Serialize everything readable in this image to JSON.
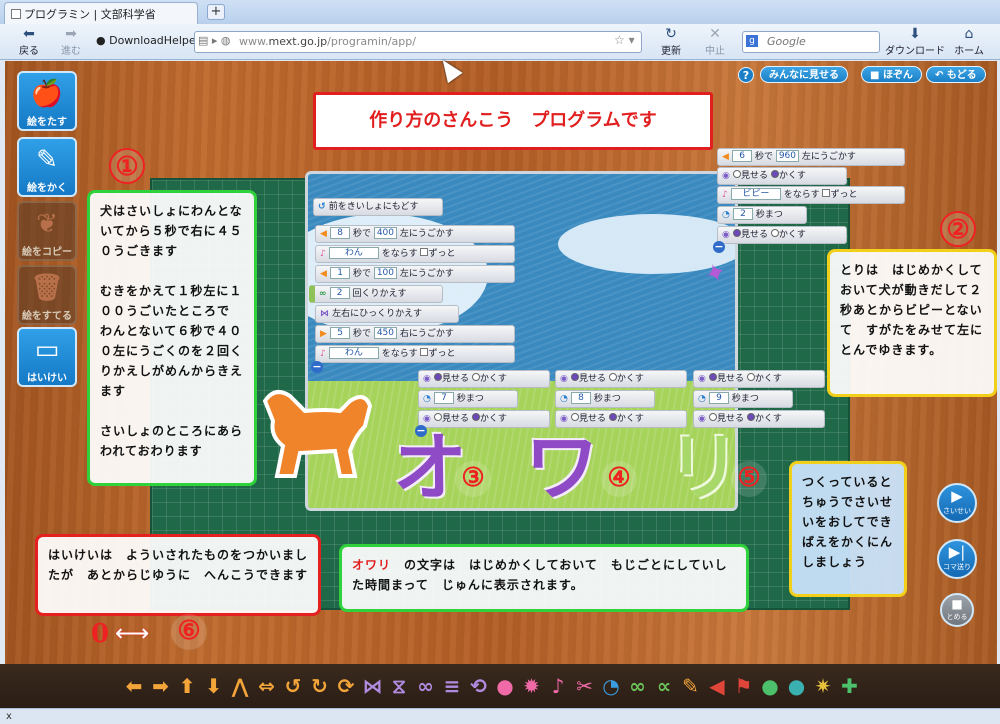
{
  "browser": {
    "tab_title": "プログラミン | 文部科学省",
    "tab_close": "×",
    "new_tab": "+",
    "nav": {
      "back": "戻る",
      "forward": "進む",
      "reload": "更新",
      "stop": "中止",
      "download": "ダウンロード",
      "home": "ホーム"
    },
    "extension": "DownloadHelper",
    "url_prefix": "www.",
    "url_domain": "mext.go.jp",
    "url_path": "/programin/app/",
    "search_placeholder": "Google",
    "search_engine_icon": "g"
  },
  "app": {
    "sidebar": [
      {
        "label": "絵をたす",
        "icon": "apple-plus-icon",
        "enabled": true
      },
      {
        "label": "絵をかく",
        "icon": "pencil-icon",
        "enabled": true
      },
      {
        "label": "絵をコピー",
        "icon": "apples-copy-icon",
        "enabled": false
      },
      {
        "label": "絵をすてる",
        "icon": "trash-icon",
        "enabled": false
      },
      {
        "label": "はいけい",
        "icon": "background-icon",
        "enabled": true
      }
    ],
    "top_buttons": {
      "help": "?",
      "share": "みんなに見せる",
      "save": "ほぞん",
      "back": "もどる"
    },
    "title_box": "作り方のさんこう　プログラムです",
    "numbers": {
      "n1": "①",
      "n2": "②",
      "n3": "③",
      "n4": "④",
      "n5": "⑤",
      "n6": "⑥",
      "n0": "0"
    },
    "callouts": {
      "dog": "犬はさいしょにわんとないてから５秒で右に４５０うごきます\n\nむきをかえて１秒左に１００うごいたところで　わんとないて６秒で４００左にうごくのを２回くりかえしがめんからきえます\n\nさいしょのところにあらわれておわります",
      "bird": "とりは　はじめかくしておいて犬が動きだして２秒あとからビピーとないて　すがたをみせて左にとんでゆきます。",
      "background": "はいけいは　よういされたものをつかいましたが　あとからじゆうに　へんこうできます",
      "owari_word": "オワリ",
      "owari_rest": "　の文字は　はじめかくしておいて　もじごとにしていした時間まって　じゅんに表示されます。",
      "play_tip": "つくっているとちゅうでさいせいをおしてできばえをかくにんしましょう"
    },
    "dog_script": {
      "reset": "前をきいしょにもどす",
      "move1": {
        "num": "8",
        "sec": "秒で",
        "dist": "400",
        "dir": "左にうごかす"
      },
      "sound1": {
        "name": "わん",
        "label": "をならす",
        "loop": "ずっと"
      },
      "move2": {
        "num": "1",
        "sec": "秒で",
        "dist": "100",
        "dir": "左にうごかす"
      },
      "repeat": {
        "num": "2",
        "label": "回くりかえす"
      },
      "flip": "左右にひっくりかえす",
      "move3": {
        "num": "5",
        "sec": "秒で",
        "dist": "450",
        "dir": "右にうごかす"
      },
      "sound2": {
        "name": "わん",
        "label": "をならす",
        "loop": "ずっと"
      }
    },
    "bird_script": {
      "move": {
        "num": "6",
        "sec": "秒で",
        "dist": "960",
        "dir": "左にうごかす"
      },
      "visible": {
        "show": "見せる",
        "hide": "かくす"
      },
      "sound": {
        "name": "ビピー",
        "label": "をならす",
        "loop": "ずっと"
      },
      "wait": {
        "num": "2",
        "label": "秒まつ"
      },
      "visible2": {
        "show": "見せる",
        "hide": "かくす"
      }
    },
    "letter_scripts": [
      {
        "letter": "オ",
        "wait": "7",
        "show": "見せる",
        "hide": "かくす",
        "wait_label": "秒まつ"
      },
      {
        "letter": "ワ",
        "wait": "8",
        "show": "見せる",
        "hide": "かくす",
        "wait_label": "秒まつ"
      },
      {
        "letter": "リ",
        "wait": "9",
        "show": "見せる",
        "hide": "かくす",
        "wait_label": "秒まつ"
      }
    ],
    "controls": {
      "play": "さいせい",
      "step": "コマ送り",
      "stop": "とめる"
    },
    "palette_icons": [
      "arrow-left",
      "arrow-right",
      "arrow-up",
      "arrow-down",
      "jump",
      "stretch",
      "rotate-left",
      "rotate-right",
      "turn",
      "flip-h",
      "flip-v",
      "chain",
      "stack",
      "repeat",
      "speech",
      "burst",
      "music",
      "tools",
      "clock",
      "infinity",
      "loop",
      "pointer",
      "horn",
      "flag",
      "green-char",
      "teal-char",
      "sparkle",
      "dino"
    ],
    "colors": {
      "accent": "#1a7fc6",
      "red": "#e11f1f",
      "green_border": "#2fd23a",
      "yellow_border": "#f2cf18",
      "letter_purple": "#8f4bc5",
      "letter_green": "#a8d86a"
    }
  },
  "status": "x"
}
